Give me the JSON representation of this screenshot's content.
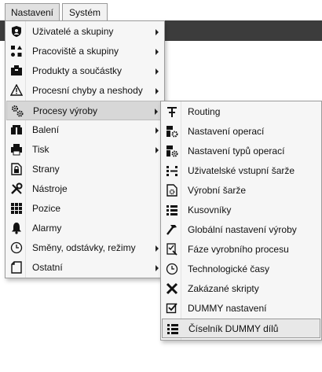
{
  "menubar": {
    "tabs": [
      {
        "label": "Nastavení"
      },
      {
        "label": "Systém"
      }
    ]
  },
  "main_menu": {
    "items": [
      {
        "label": "Uživatelé a skupiny",
        "icon": "shield-icon",
        "submenu": true
      },
      {
        "label": "Pracoviště a skupiny",
        "icon": "shapes-icon",
        "submenu": true
      },
      {
        "label": "Produkty a součástky",
        "icon": "box-icon",
        "submenu": true
      },
      {
        "label": "Procesní chyby a neshody",
        "icon": "warning-icon",
        "submenu": true
      },
      {
        "label": "Procesy výroby",
        "icon": "gears-icon",
        "submenu": true
      },
      {
        "label": "Balení",
        "icon": "package-icon",
        "submenu": true
      },
      {
        "label": "Tisk",
        "icon": "printer-icon",
        "submenu": true
      },
      {
        "label": "Strany",
        "icon": "document-lock-icon",
        "submenu": false
      },
      {
        "label": "Nástroje",
        "icon": "tools-icon",
        "submenu": false
      },
      {
        "label": "Pozice",
        "icon": "grid-icon",
        "submenu": false
      },
      {
        "label": "Alarmy",
        "icon": "bell-icon",
        "submenu": false
      },
      {
        "label": "Směny, odstávky, režimy",
        "icon": "clock-icon",
        "submenu": true
      },
      {
        "label": "Ostatní",
        "icon": "file-icon",
        "submenu": true
      }
    ]
  },
  "sub_menu": {
    "items": [
      {
        "label": "Routing",
        "icon": "routing-icon"
      },
      {
        "label": "Nastavení operací",
        "icon": "operation-settings-icon"
      },
      {
        "label": "Nastavení typů operací",
        "icon": "operation-types-icon"
      },
      {
        "label": "Uživatelské vstupní šarže",
        "icon": "input-batch-icon"
      },
      {
        "label": "Výrobní šarže",
        "icon": "production-batch-icon"
      },
      {
        "label": "Kusovníky",
        "icon": "list-icon"
      },
      {
        "label": "Globální nastavení výroby",
        "icon": "hammer-icon"
      },
      {
        "label": "Fáze vyrobního procesu",
        "icon": "phase-icon"
      },
      {
        "label": "Technologické časy",
        "icon": "clock-icon"
      },
      {
        "label": "Zakázané skripty",
        "icon": "x-icon"
      },
      {
        "label": "DUMMY nastavení",
        "icon": "checkbox-icon"
      },
      {
        "label": "Číselník DUMMY dílů",
        "icon": "list-icon"
      }
    ]
  },
  "colors": {
    "darkbar": "#3c3c3c",
    "menu_bg": "#f6f6f6",
    "selected_bg": "#d7d7d7"
  }
}
